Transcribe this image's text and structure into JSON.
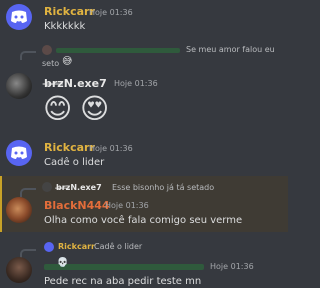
{
  "colors": {
    "background": "#36393f",
    "rickcarr": "#e0b341",
    "brzn": "#e7e7e7",
    "blackn": "#e36d3a",
    "mention_highlight": "#c9a227",
    "discord_blurple": "#5865f2"
  },
  "messages": [
    {
      "author": "Rickcarr",
      "time": "Hoje 01:36",
      "text": "Kkkkkkk"
    },
    {
      "reply_text_1": "Se meu amor falou eu",
      "reply_text_2": "seto"
    },
    {
      "author": "b̶r̶z̶N.exe7",
      "time": "Hoje 01:36",
      "emoji_1": "😊",
      "emoji_2": "😍"
    },
    {
      "author": "Rickcarr",
      "time": "Hoje 01:36",
      "text": "Cadê o lider"
    },
    {
      "reply_author": "b̶r̶z̶N.exe7",
      "reply_text": "Esse bisonho já tá setado",
      "author": "BlackN444",
      "time": "Hoje 01:36",
      "text": "Olha como você fala comigo seu verme"
    },
    {
      "reply_author": "Rickcarr",
      "reply_text": "Cadê o lider",
      "time": "Hoje 01:36",
      "text": "Pede rec na aba pedir teste mn"
    }
  ]
}
